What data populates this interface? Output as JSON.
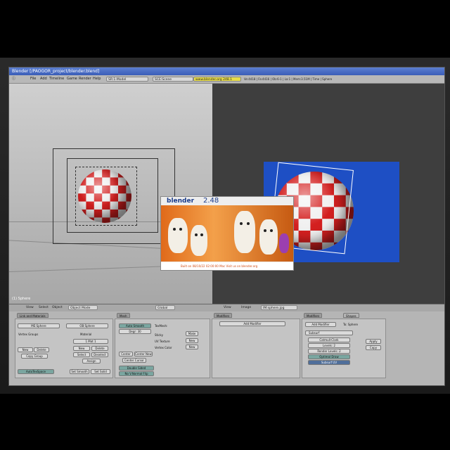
{
  "window": {
    "title": "Blender [/PAOGOR_project/blender.blend]"
  },
  "menu": {
    "items": [
      "File",
      "Add",
      "Timeline",
      "Game",
      "Render",
      "Help"
    ],
    "screen": "SR:1-Model",
    "scene": "SCE:Scene",
    "url": "www.blender.org 248.1",
    "stats": "Ve:4418 | Fa:4416 | Ob:6-1 | La:1 | Mem:3.51M | Time | Sphere"
  },
  "viewport_left": {
    "label": "(1) Sphere"
  },
  "splash": {
    "logo": "blender",
    "version": "2.48",
    "footer": "Built on 08/10/22 02:00:00  Mac   Visit us on blender.org"
  },
  "header3d": {
    "items": [
      "View",
      "Select",
      "Object",
      "Object Mode",
      "Global"
    ],
    "image_menu": [
      "View",
      "Image"
    ],
    "image_name": "IM:sphere.jpg"
  },
  "panels": {
    "link_materials": {
      "tab": "Link and Materials",
      "me": "ME:Sphere",
      "ob": "OB:Sphere",
      "vertex_groups": "Vertex Groups",
      "material": "Material",
      "mat_slot": "1 Mat 1",
      "buttons": [
        "New",
        "Delete",
        "Copy Group",
        "New",
        "Delete",
        "Select",
        "Deselect",
        "Assign"
      ],
      "autotexspace": "AutoTexSpace",
      "set_smooth": "Set Smooth",
      "set_solid": "Set Solid"
    },
    "mesh": {
      "tab": "Mesh",
      "auto_smooth": "Auto Smooth",
      "degr": "Degr: 30",
      "texmesh": "TexMesh:",
      "sticky": "Sticky",
      "uv_texture": "UV Texture",
      "vertex_color": "Vertex Color",
      "make": "Make",
      "new": "New",
      "new2": "New",
      "center": "Center",
      "center_new": "Center New",
      "center_cursor": "Center Cursor",
      "double_sided": "Double Sided",
      "no_vnormal": "No V.Normal Flip"
    },
    "modifiers": {
      "tab": "Modifiers",
      "add": "Add Modifier",
      "to": "To: Sphere",
      "name": "Subsurf",
      "type": "Catmull-Clark",
      "levels": "Levels: 2",
      "render_levels": "Render Levels: 2",
      "optimal": "Optimal Draw",
      "subsurf_uv": "Subsurf UV",
      "apply": "Apply",
      "copy": "Copy"
    },
    "modifiers_tabs": [
      "Modifiers",
      "Shapes"
    ]
  }
}
